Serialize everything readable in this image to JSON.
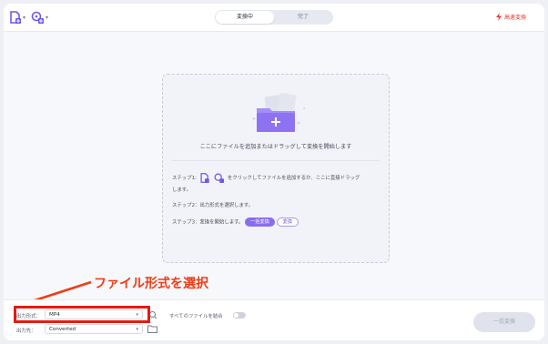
{
  "header": {
    "tabs": [
      {
        "label": "変換中",
        "active": true
      },
      {
        "label": "完了",
        "active": false
      }
    ],
    "high_speed_label": "高速変換",
    "add_file_icon": "file-add-icon",
    "add_media_icon": "media-add-icon"
  },
  "dropzone": {
    "main_text": "ここにファイルを追加またはドラッグして変換を開始します",
    "step1_prefix": "ステップ1:",
    "step1_text": "をクリックしてファイルを追加するか、ここに直接ドラッグ",
    "step1_text2": "します。",
    "step2_text": "ステップ2：出力形式を選択します。",
    "step3_text": "ステップ3：変換を開始します。",
    "convert_all_pill": "一括変換",
    "convert_pill": "変換"
  },
  "annotation": {
    "text": "ファイル形式を選択"
  },
  "bottom": {
    "format_label": "出力形式：",
    "format_value": "MP4",
    "dest_label": "出力先：",
    "dest_value": "Converted",
    "merge_label": "すべてのファイルを結合",
    "convert_all_button": "一括変換"
  },
  "colors": {
    "accent": "#8a6cf0",
    "annotation_red": "#f03b16",
    "speed_red": "#e8382b"
  }
}
